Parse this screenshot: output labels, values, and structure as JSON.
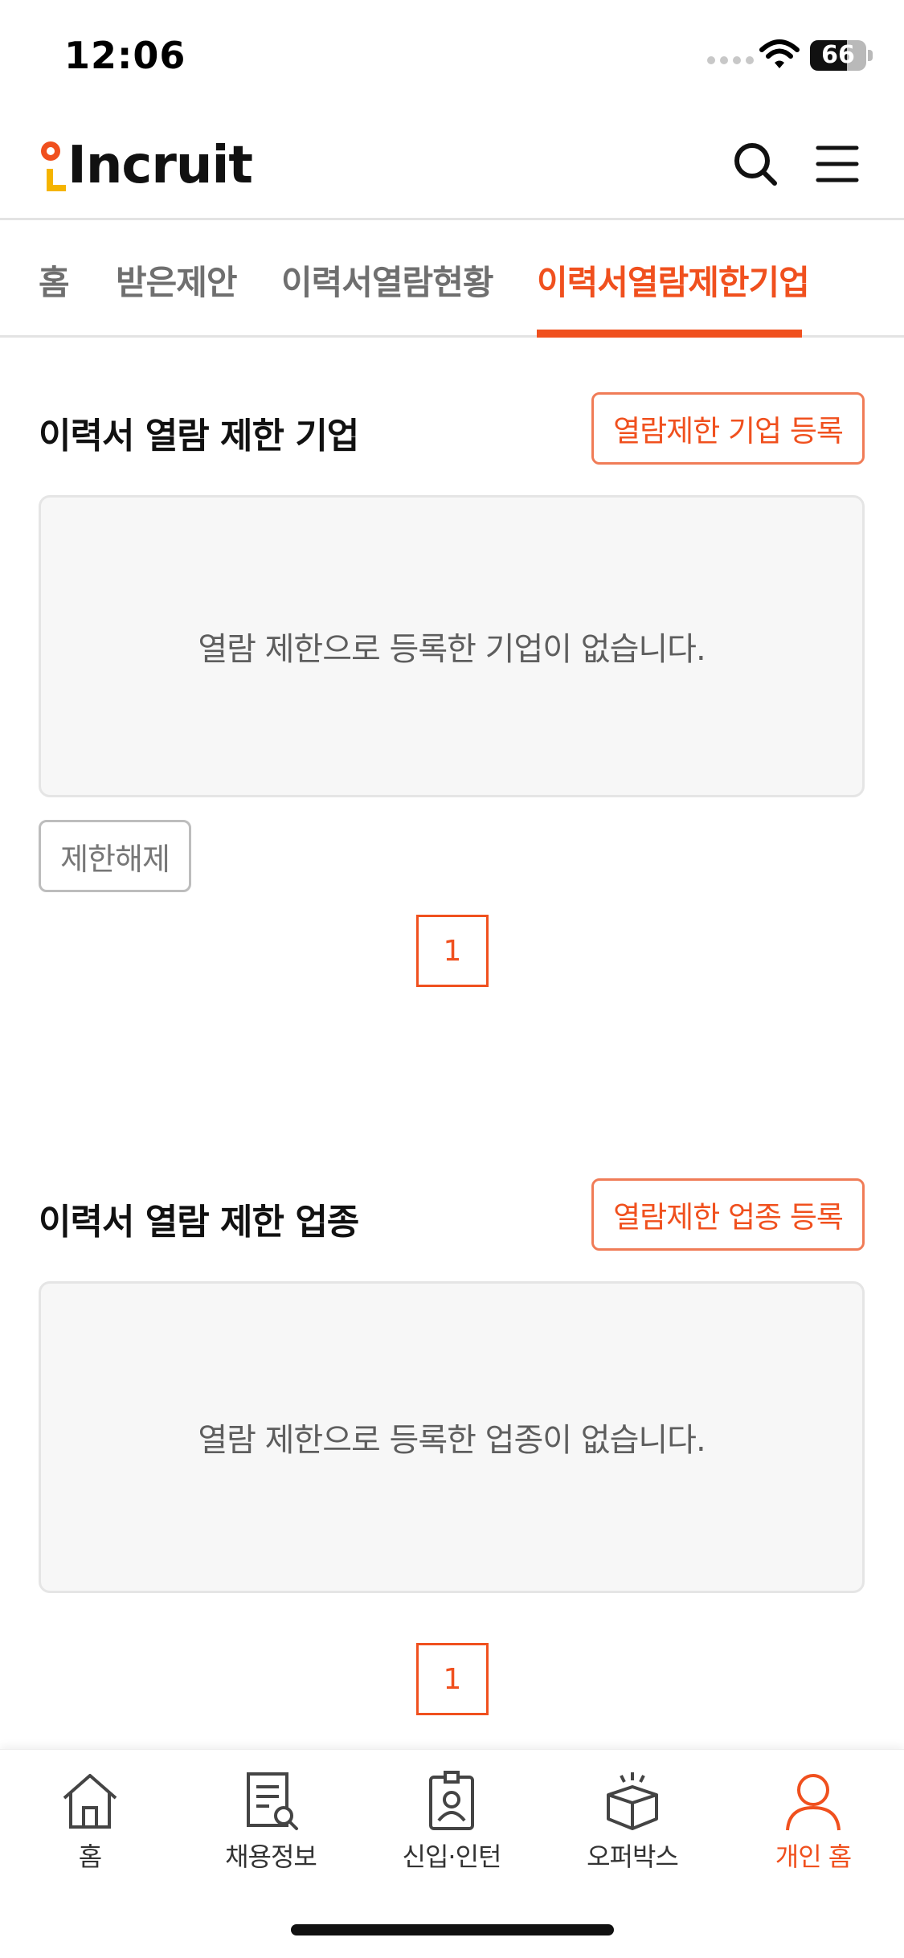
{
  "status_bar": {
    "time": "12:06",
    "battery": "66",
    "battery_level": 0.66
  },
  "header": {
    "logo_text": "Incruit"
  },
  "tabs": [
    {
      "label": "홈",
      "active": false
    },
    {
      "label": "받은제안",
      "active": false
    },
    {
      "label": "이력서열람현황",
      "active": false
    },
    {
      "label": "이력서열람제한기업",
      "active": true
    }
  ],
  "company_section": {
    "title": "이력서 열람 제한 기업",
    "register_button": "열람제한 기업 등록",
    "empty_message": "열람 제한으로 등록한 기업이 없습니다.",
    "release_button": "제한해제",
    "page": "1"
  },
  "industry_section": {
    "title": "이력서 열람 제한 업종",
    "register_button": "열람제한 업종 등록",
    "empty_message": "열람 제한으로 등록한 업종이 없습니다.",
    "page": "1"
  },
  "bottom_nav": [
    {
      "label": "홈",
      "icon": "house-icon",
      "active": false
    },
    {
      "label": "채용정보",
      "icon": "document-search-icon",
      "active": false
    },
    {
      "label": "신입·인턴",
      "icon": "id-badge-icon",
      "active": false
    },
    {
      "label": "오퍼박스",
      "icon": "gift-box-icon",
      "active": false
    },
    {
      "label": "개인 홈",
      "icon": "person-icon",
      "active": true
    }
  ],
  "colors": {
    "accent": "#f0501e",
    "logo_yellow": "#f5b400",
    "text_dark": "#111111",
    "text_gray": "#6f6f6f"
  }
}
